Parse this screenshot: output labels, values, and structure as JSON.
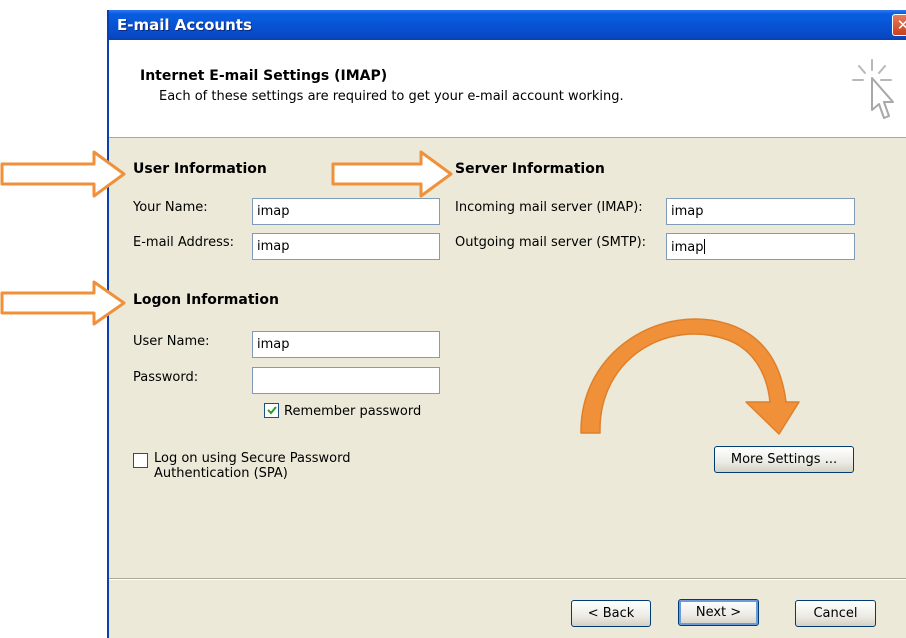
{
  "window": {
    "title": "E-mail Accounts",
    "close_glyph": "✕"
  },
  "header": {
    "title": "Internet E-mail Settings (IMAP)",
    "subtitle": "Each of these settings are required to get your e-mail account working.",
    "icon": "wizard-cursor-icon"
  },
  "user_info": {
    "heading": "User Information",
    "name_label": "Your Name:",
    "name_value": "imap",
    "email_label": "E-mail Address:",
    "email_value": "imap"
  },
  "server_info": {
    "heading": "Server Information",
    "incoming_label": "Incoming mail server (IMAP):",
    "incoming_value": "imap",
    "outgoing_label": "Outgoing mail server (SMTP):",
    "outgoing_value": "imap"
  },
  "logon_info": {
    "heading": "Logon Information",
    "username_label": "User Name:",
    "username_value": "imap",
    "password_label": "Password:",
    "password_value": "",
    "remember_label": "Remember password",
    "remember_checked": true,
    "spa_label_line1": "Log on using Secure Password",
    "spa_label_line2": "Authentication (SPA)",
    "spa_checked": false
  },
  "buttons": {
    "more_settings": "More Settings ...",
    "back": "< Back",
    "next": "Next >",
    "cancel": "Cancel"
  },
  "annotations": {
    "arrow_color": "#f0913a",
    "arrow_fill": "#ffffff"
  }
}
